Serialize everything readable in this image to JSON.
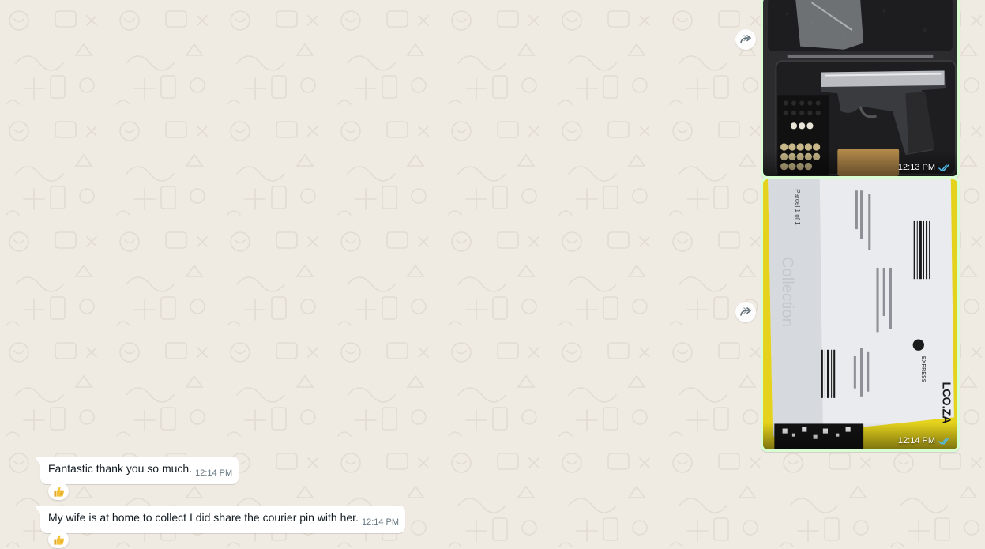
{
  "colors": {
    "chat_background": "#efeae2",
    "outgoing_bubble": "#d9fdd3",
    "incoming_bubble": "#ffffff",
    "read_ticks": "#53bdeb",
    "meta_text": "#667781"
  },
  "messages": {
    "image1": {
      "time": "12:13 PM",
      "status_icon": "double-check-read-icon"
    },
    "image2": {
      "time": "12:14 PM",
      "status_icon": "double-check-read-icon",
      "visible_label_text": [
        "Parcel 1 of 1",
        "Collection",
        "EXPRESS",
        "LCO.ZA"
      ]
    },
    "msg1": {
      "text": "Fantastic thank you so much.",
      "time": "12:14 PM",
      "reaction": "thumbs-up-icon"
    },
    "msg2": {
      "text": "My wife is at home to collect I did share the courier pin with her.",
      "time": "12:14 PM",
      "reaction": "thumbs-up-icon"
    }
  },
  "icons": {
    "forward": "forward-icon",
    "reaction": "thumbs-up-icon",
    "status": "double-check-read-icon"
  }
}
